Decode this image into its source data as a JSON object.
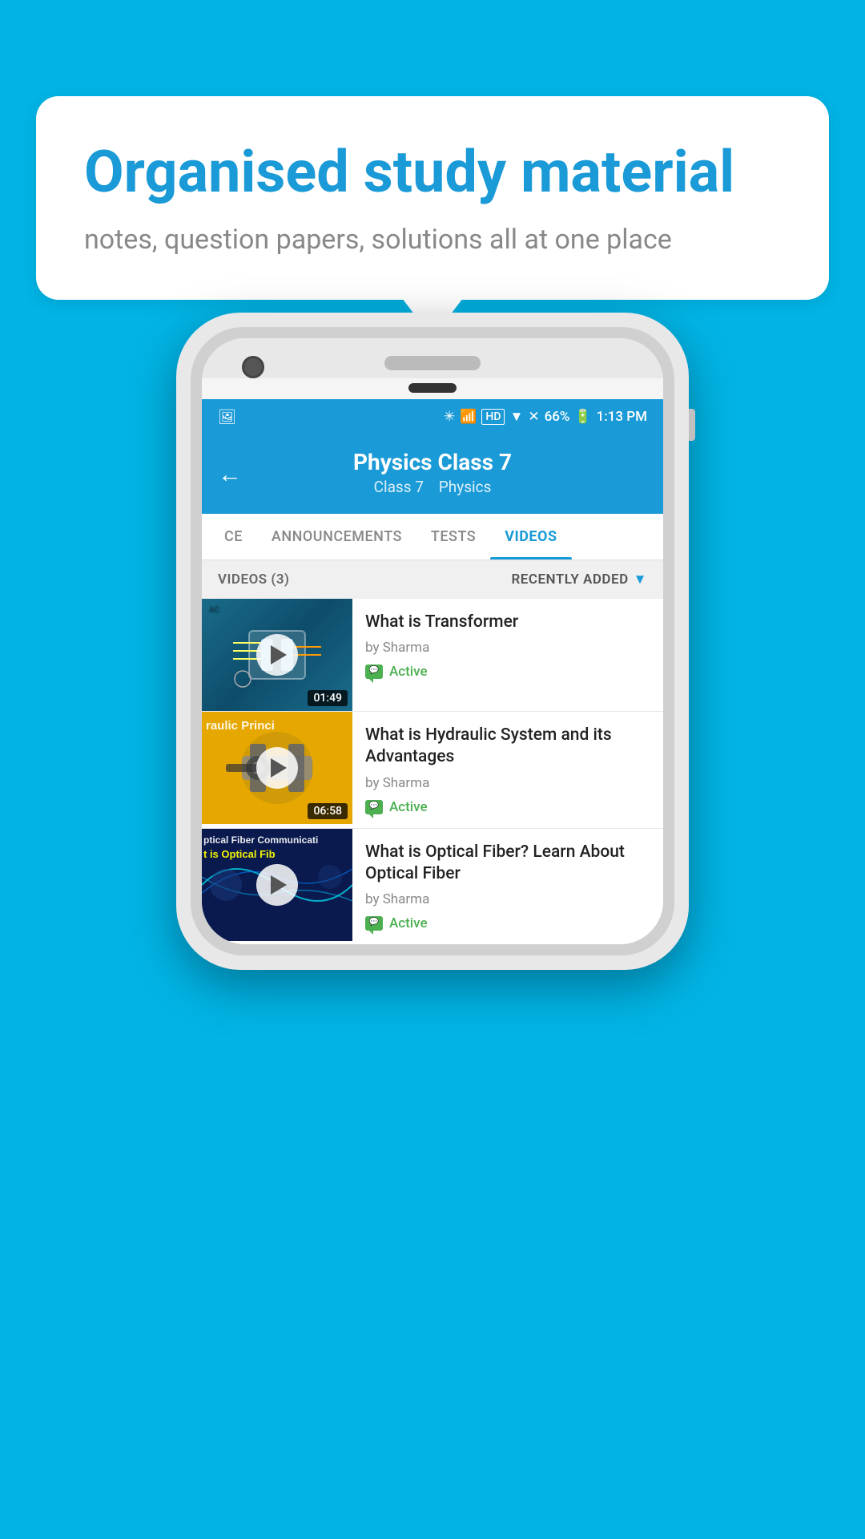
{
  "background_color": "#00b4e5",
  "bubble": {
    "title": "Organised study material",
    "subtitle": "notes, question papers, solutions all at one place"
  },
  "phone": {
    "status_bar": {
      "battery": "66%",
      "time": "1:13 PM",
      "signal": "HD"
    },
    "header": {
      "title": "Physics Class 7",
      "subtitle_class": "Class 7",
      "subtitle_subject": "Physics",
      "back_label": "←"
    },
    "tabs": [
      {
        "label": "CE",
        "active": false
      },
      {
        "label": "ANNOUNCEMENTS",
        "active": false
      },
      {
        "label": "TESTS",
        "active": false
      },
      {
        "label": "VIDEOS",
        "active": true
      }
    ],
    "videos_section": {
      "count_label": "VIDEOS (3)",
      "sort_label": "RECENTLY ADDED",
      "videos": [
        {
          "title": "What is  Transformer",
          "author": "by Sharma",
          "status": "Active",
          "duration": "01:49",
          "thumb_type": "transformer"
        },
        {
          "title": "What is Hydraulic System and its Advantages",
          "author": "by Sharma",
          "status": "Active",
          "duration": "06:58",
          "thumb_type": "hydraulic",
          "thumb_text": "raulic Princi"
        },
        {
          "title": "What is Optical Fiber? Learn About Optical Fiber",
          "author": "by Sharma",
          "status": "Active",
          "duration": "",
          "thumb_type": "optical",
          "thumb_text": "ptical Fiber Communicati",
          "thumb_text2": "t is Optical Fib"
        }
      ]
    }
  }
}
